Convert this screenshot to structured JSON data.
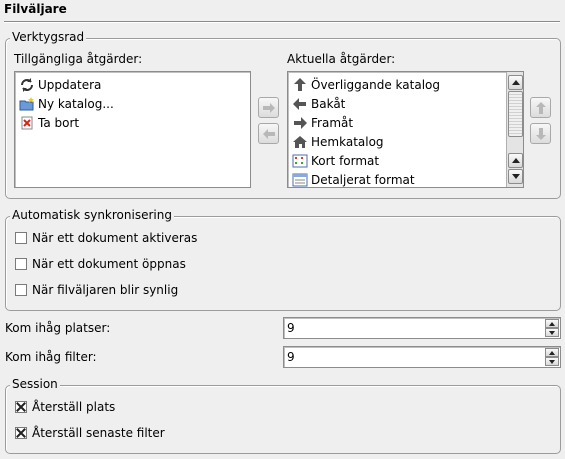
{
  "title": "Filväljare",
  "toolbar": {
    "legend": "Verktygsrad",
    "available_label": "Tillgängliga åtgärder:",
    "current_label": "Aktuella åtgärder:",
    "available_items": [
      {
        "label": "Uppdatera",
        "icon": "reload-icon"
      },
      {
        "label": "Ny katalog...",
        "icon": "new-folder-icon"
      },
      {
        "label": "Ta bort",
        "icon": "delete-icon"
      }
    ],
    "current_items": [
      {
        "label": "Överliggande katalog",
        "icon": "arrow-up-icon"
      },
      {
        "label": "Bakåt",
        "icon": "arrow-left-icon"
      },
      {
        "label": "Framåt",
        "icon": "arrow-right-icon"
      },
      {
        "label": "Hemkatalog",
        "icon": "home-icon"
      },
      {
        "label": "Kort format",
        "icon": "short-view-icon"
      },
      {
        "label": "Detaljerat format",
        "icon": "detailed-view-icon"
      }
    ]
  },
  "autosync": {
    "legend": "Automatisk synkronisering",
    "options": [
      {
        "label": "När ett dokument aktiveras",
        "checked": false
      },
      {
        "label": "När ett dokument öppnas",
        "checked": false
      },
      {
        "label": "När filväljaren blir synlig",
        "checked": false
      }
    ]
  },
  "remember_places": {
    "label": "Kom ihåg platser:",
    "value": "9"
  },
  "remember_filters": {
    "label": "Kom ihåg filter:",
    "value": "9"
  },
  "session": {
    "legend": "Session",
    "options": [
      {
        "label": "Återställ plats",
        "checked": true
      },
      {
        "label": "Återställ senaste filter",
        "checked": true
      }
    ]
  }
}
